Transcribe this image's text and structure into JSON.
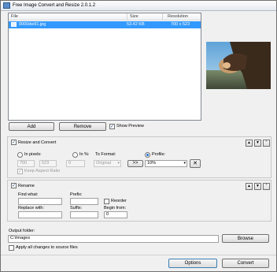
{
  "window": {
    "title": "Free Image Convert and Resize 2.0.1.2"
  },
  "file_list": {
    "columns": {
      "name": "File",
      "size": "Size",
      "resolution": "Resolution"
    },
    "rows": [
      {
        "name": "0000dw91.jpg",
        "size": "53.42 KB",
        "resolution": "700 x 523",
        "selected": true
      }
    ]
  },
  "list_buttons": {
    "add": "Add",
    "remove": "Remove",
    "show_preview": "Show Preview"
  },
  "resize": {
    "title": "Resize and Convert",
    "in_pixels": "In pixels:",
    "in_percent": "In %:",
    "to_format": "To Format:",
    "profile": "Profile:",
    "width": "700",
    "height": "523",
    "percent": "0",
    "format": "Original",
    "format_button": ">>",
    "profile_value": "10%",
    "delete_profile_icon": "x-icon",
    "keep_aspect": "Keep Aspect Ratio"
  },
  "rename": {
    "title": "Rename",
    "find_what": "Find what:",
    "prefix": "Prefix:",
    "reorder": "Reorder",
    "replace_with": "Replace with:",
    "suffix": "Suffix:",
    "begin_from": "Begin from:",
    "begin_value": "0"
  },
  "output": {
    "label": "Output folder:",
    "path": "C:\\Images",
    "browse": "Browse",
    "apply_all": "Apply all changes to source files"
  },
  "footer": {
    "options": "Options",
    "convert": "Convert"
  },
  "section_controls": {
    "up": "up-icon",
    "down": "down-icon",
    "collapse": "collapse-icon"
  }
}
